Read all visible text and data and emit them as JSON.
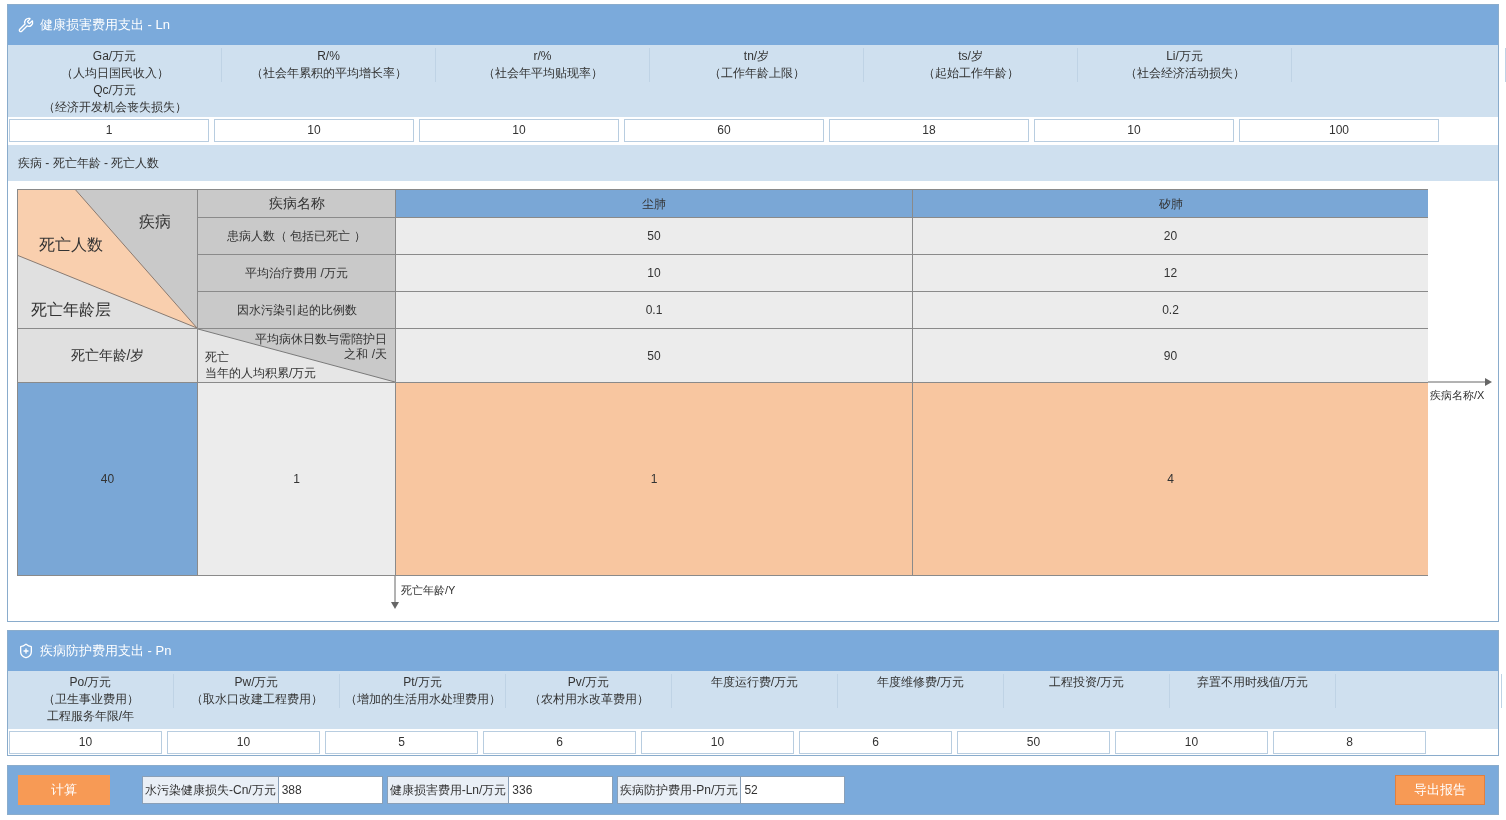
{
  "health_loss": {
    "title": "健康损害费用支出 - Ln",
    "param_columns": [
      {
        "labels": [
          "Ga/万元",
          "（人均日国民收入）",
          "Qc/万元",
          "（经济开发机会丧失损失）"
        ]
      },
      {
        "labels": [
          "R/%",
          "（社会年累积的平均增长率）"
        ]
      },
      {
        "labels": [
          "r/%",
          "（社会年平均贴现率）"
        ]
      },
      {
        "labels": [
          "tn/岁",
          "（工作年龄上限）"
        ]
      },
      {
        "labels": [
          "ts/岁",
          "（起始工作年龄）"
        ]
      },
      {
        "labels": [
          "Li/万元",
          "（社会经济活动损失）"
        ]
      },
      {}
    ],
    "param_values": [
      "1",
      "10",
      "10",
      "60",
      "18",
      "10",
      "100"
    ]
  },
  "disease_table": {
    "title": "疾病 - 死亡年龄 - 死亡人数",
    "corner": {
      "top_right": "疾病",
      "middle": "死亡人数",
      "bottom_left": "死亡年龄层"
    },
    "name_header": "疾病名称",
    "row_labels": [
      "患病人数（ 包括已死亡 ）",
      "平均治疗费用 /万元",
      "因水污染引起的比例数"
    ],
    "age_header": "死亡年龄/岁",
    "split_header": {
      "top": [
        "平均病休日数与需陪护日",
        "之和 /天"
      ],
      "bottom": [
        "死亡",
        "当年的人均积累/万元"
      ]
    },
    "diseases": [
      {
        "name": "尘肺",
        "values": [
          "50",
          "10",
          "0.1"
        ],
        "days": "50",
        "deaths": "1"
      },
      {
        "name": "矽肺",
        "values": [
          "20",
          "12",
          "0.2"
        ],
        "days": "90",
        "deaths": "4"
      }
    ],
    "age_row": {
      "age": "40",
      "accumulation": "1"
    },
    "x_axis": "疾病名称/X",
    "y_axis": "死亡年龄/Y"
  },
  "prevention": {
    "title": "疾病防护费用支出 - Pn",
    "param_columns": [
      {
        "labels": [
          "Po/万元",
          "（卫生事业费用）",
          "工程服务年限/年"
        ]
      },
      {
        "labels": [
          "Pw/万元",
          "（取水口改建工程费用）"
        ]
      },
      {
        "labels": [
          "Pt/万元",
          "（增加的生活用水处理费用）"
        ]
      },
      {
        "labels": [
          "Pv/万元",
          "（农村用水改革费用）"
        ]
      },
      {
        "labels": [
          "年度运行费/万元"
        ]
      },
      {
        "labels": [
          "年度维修费/万元"
        ]
      },
      {
        "labels": [
          "工程投资/万元"
        ]
      },
      {
        "labels": [
          "弃置不用时残值/万元"
        ]
      },
      {}
    ],
    "param_values": [
      "10",
      "10",
      "5",
      "6",
      "10",
      "6",
      "50",
      "10",
      "8"
    ]
  },
  "footer": {
    "calculate_button": "计算",
    "results": [
      {
        "label": "水污染健康损失-Cn/万元",
        "value": "388"
      },
      {
        "label": "健康损害费用-Ln/万元",
        "value": "336"
      },
      {
        "label": "疾病防护费用-Pn/万元",
        "value": "52"
      }
    ],
    "export_button": "导出报告"
  }
}
